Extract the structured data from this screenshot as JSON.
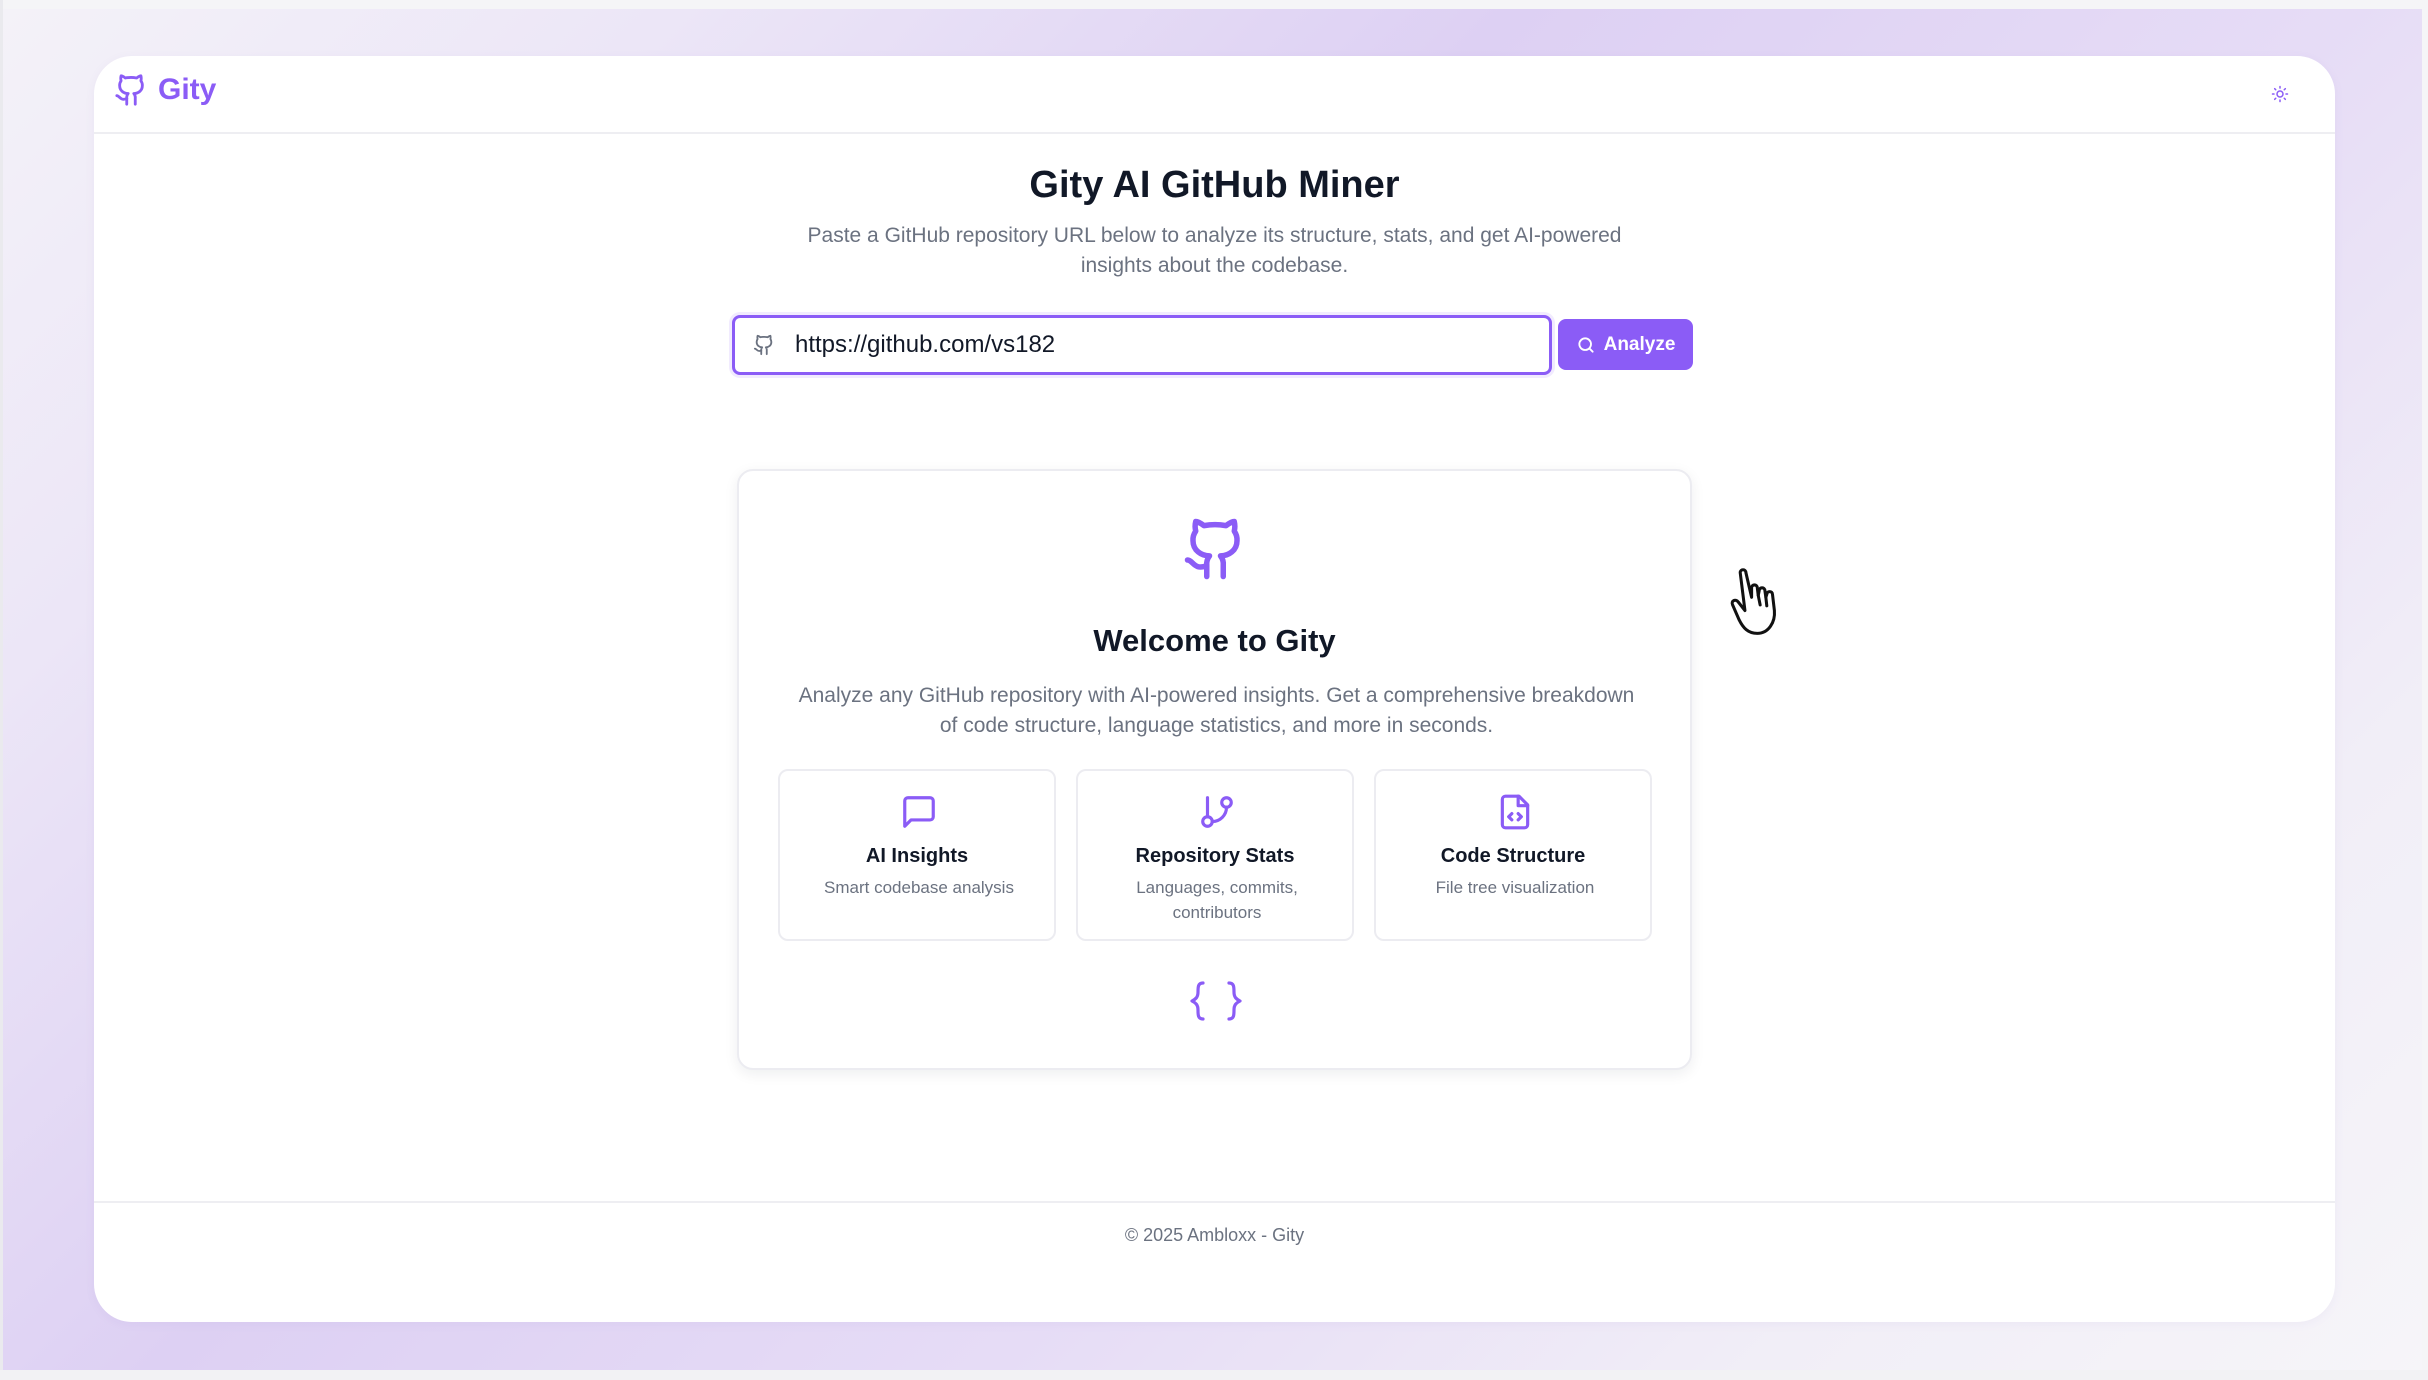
{
  "app": {
    "name": "Gity"
  },
  "header": {
    "theme_toggle_icon": "sun-icon"
  },
  "hero": {
    "title": "Gity AI GitHub Miner",
    "subtitle": "Paste a GitHub repository URL below to analyze its structure, stats, and get AI-powered insights about the codebase."
  },
  "search": {
    "value": "https://github.com/vs182",
    "button_label": "Analyze",
    "icon": "github-icon",
    "button_icon": "search-icon"
  },
  "welcome": {
    "title": "Welcome to Gity",
    "description": "Analyze any GitHub repository with AI-powered insights. Get a comprehensive breakdown of code structure, language statistics, and more in seconds.",
    "features": [
      {
        "icon": "message-square-icon",
        "title": "AI Insights",
        "subtitle": "Smart codebase analysis"
      },
      {
        "icon": "git-branch-icon",
        "title": "Repository Stats",
        "subtitle": "Languages, commits, contributors"
      },
      {
        "icon": "file-code-icon",
        "title": "Code Structure",
        "subtitle": "File tree visualization"
      }
    ],
    "bottom_icon": "braces-icon"
  },
  "footer": {
    "copyright": "© 2025 Ambloxx - Gity"
  },
  "colors": {
    "accent": "#8b5cf6",
    "heading": "#111827",
    "muted": "#6b7280",
    "border": "#ececf1"
  }
}
